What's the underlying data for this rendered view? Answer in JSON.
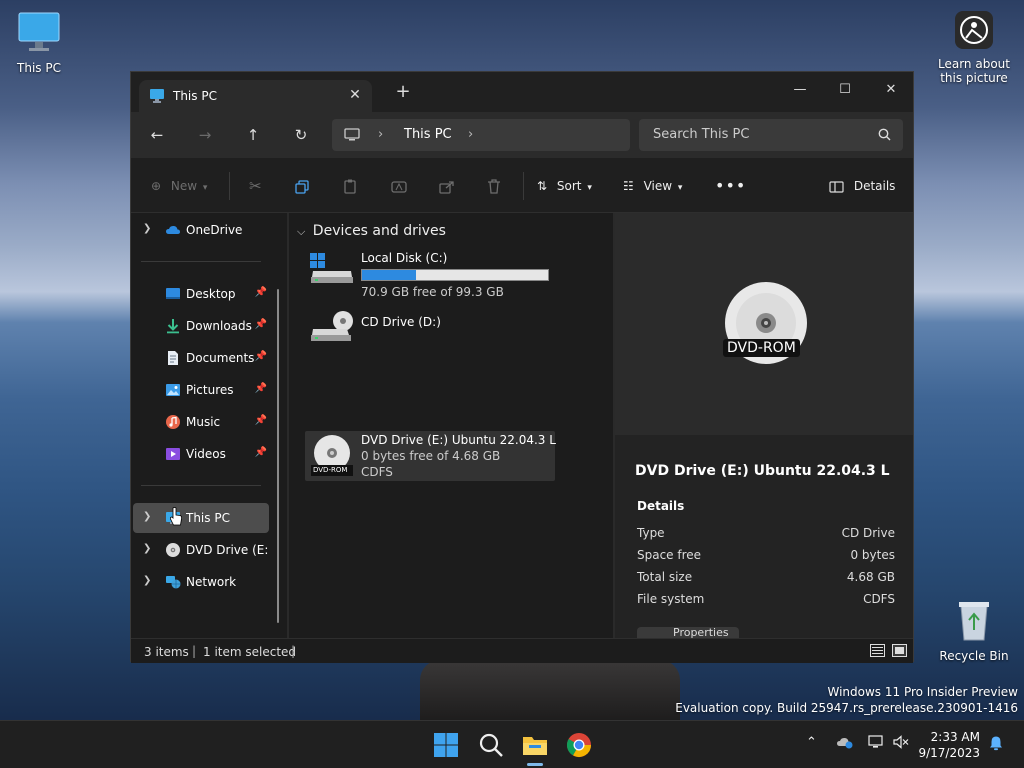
{
  "desktop": {
    "icons": {
      "this_pc": "This PC",
      "learn": "Learn about this picture",
      "recycle": "Recycle Bin"
    },
    "watermark": {
      "line1": "Windows 11 Pro Insider Preview",
      "line2": "Evaluation copy. Build 25947.rs_prerelease.230901-1416"
    }
  },
  "window": {
    "tab_title": "This PC",
    "address": {
      "crumb": "This PC"
    },
    "search": {
      "placeholder": "Search This PC"
    },
    "toolbar": {
      "new": "New",
      "sort": "Sort",
      "view": "View",
      "details": "Details"
    },
    "sidebar": {
      "onedrive": "OneDrive",
      "quick": [
        {
          "label": "Desktop"
        },
        {
          "label": "Downloads"
        },
        {
          "label": "Documents"
        },
        {
          "label": "Pictures"
        },
        {
          "label": "Music"
        },
        {
          "label": "Videos"
        }
      ],
      "this_pc": "This PC",
      "dvd": "DVD Drive (E:) U",
      "network": "Network"
    },
    "content": {
      "group": "Devices and drives",
      "drives": [
        {
          "name": "Local Disk (C:)",
          "sub": "70.9 GB free of 99.3 GB",
          "used_fraction": 0.29
        },
        {
          "name": "CD Drive (D:)"
        },
        {
          "name": "DVD Drive (E:) Ubuntu 22.04.3 L",
          "sub1": "0 bytes free of 4.68 GB",
          "sub2": "CDFS",
          "badge": "DVD-ROM"
        }
      ]
    },
    "details": {
      "preview_tag": "DVD-ROM",
      "title": "DVD Drive (E:) Ubuntu 22.04.3 L",
      "section": "Details",
      "rows": [
        {
          "k": "Type",
          "v": "CD Drive"
        },
        {
          "k": "Space free",
          "v": "0 bytes"
        },
        {
          "k": "Total size",
          "v": "4.68 GB"
        },
        {
          "k": "File system",
          "v": "CDFS"
        }
      ],
      "properties": "Properties"
    },
    "status": {
      "items": "3 items",
      "selected": "1 item selected"
    }
  },
  "taskbar": {
    "time": "2:33 AM",
    "date": "9/17/2023"
  }
}
